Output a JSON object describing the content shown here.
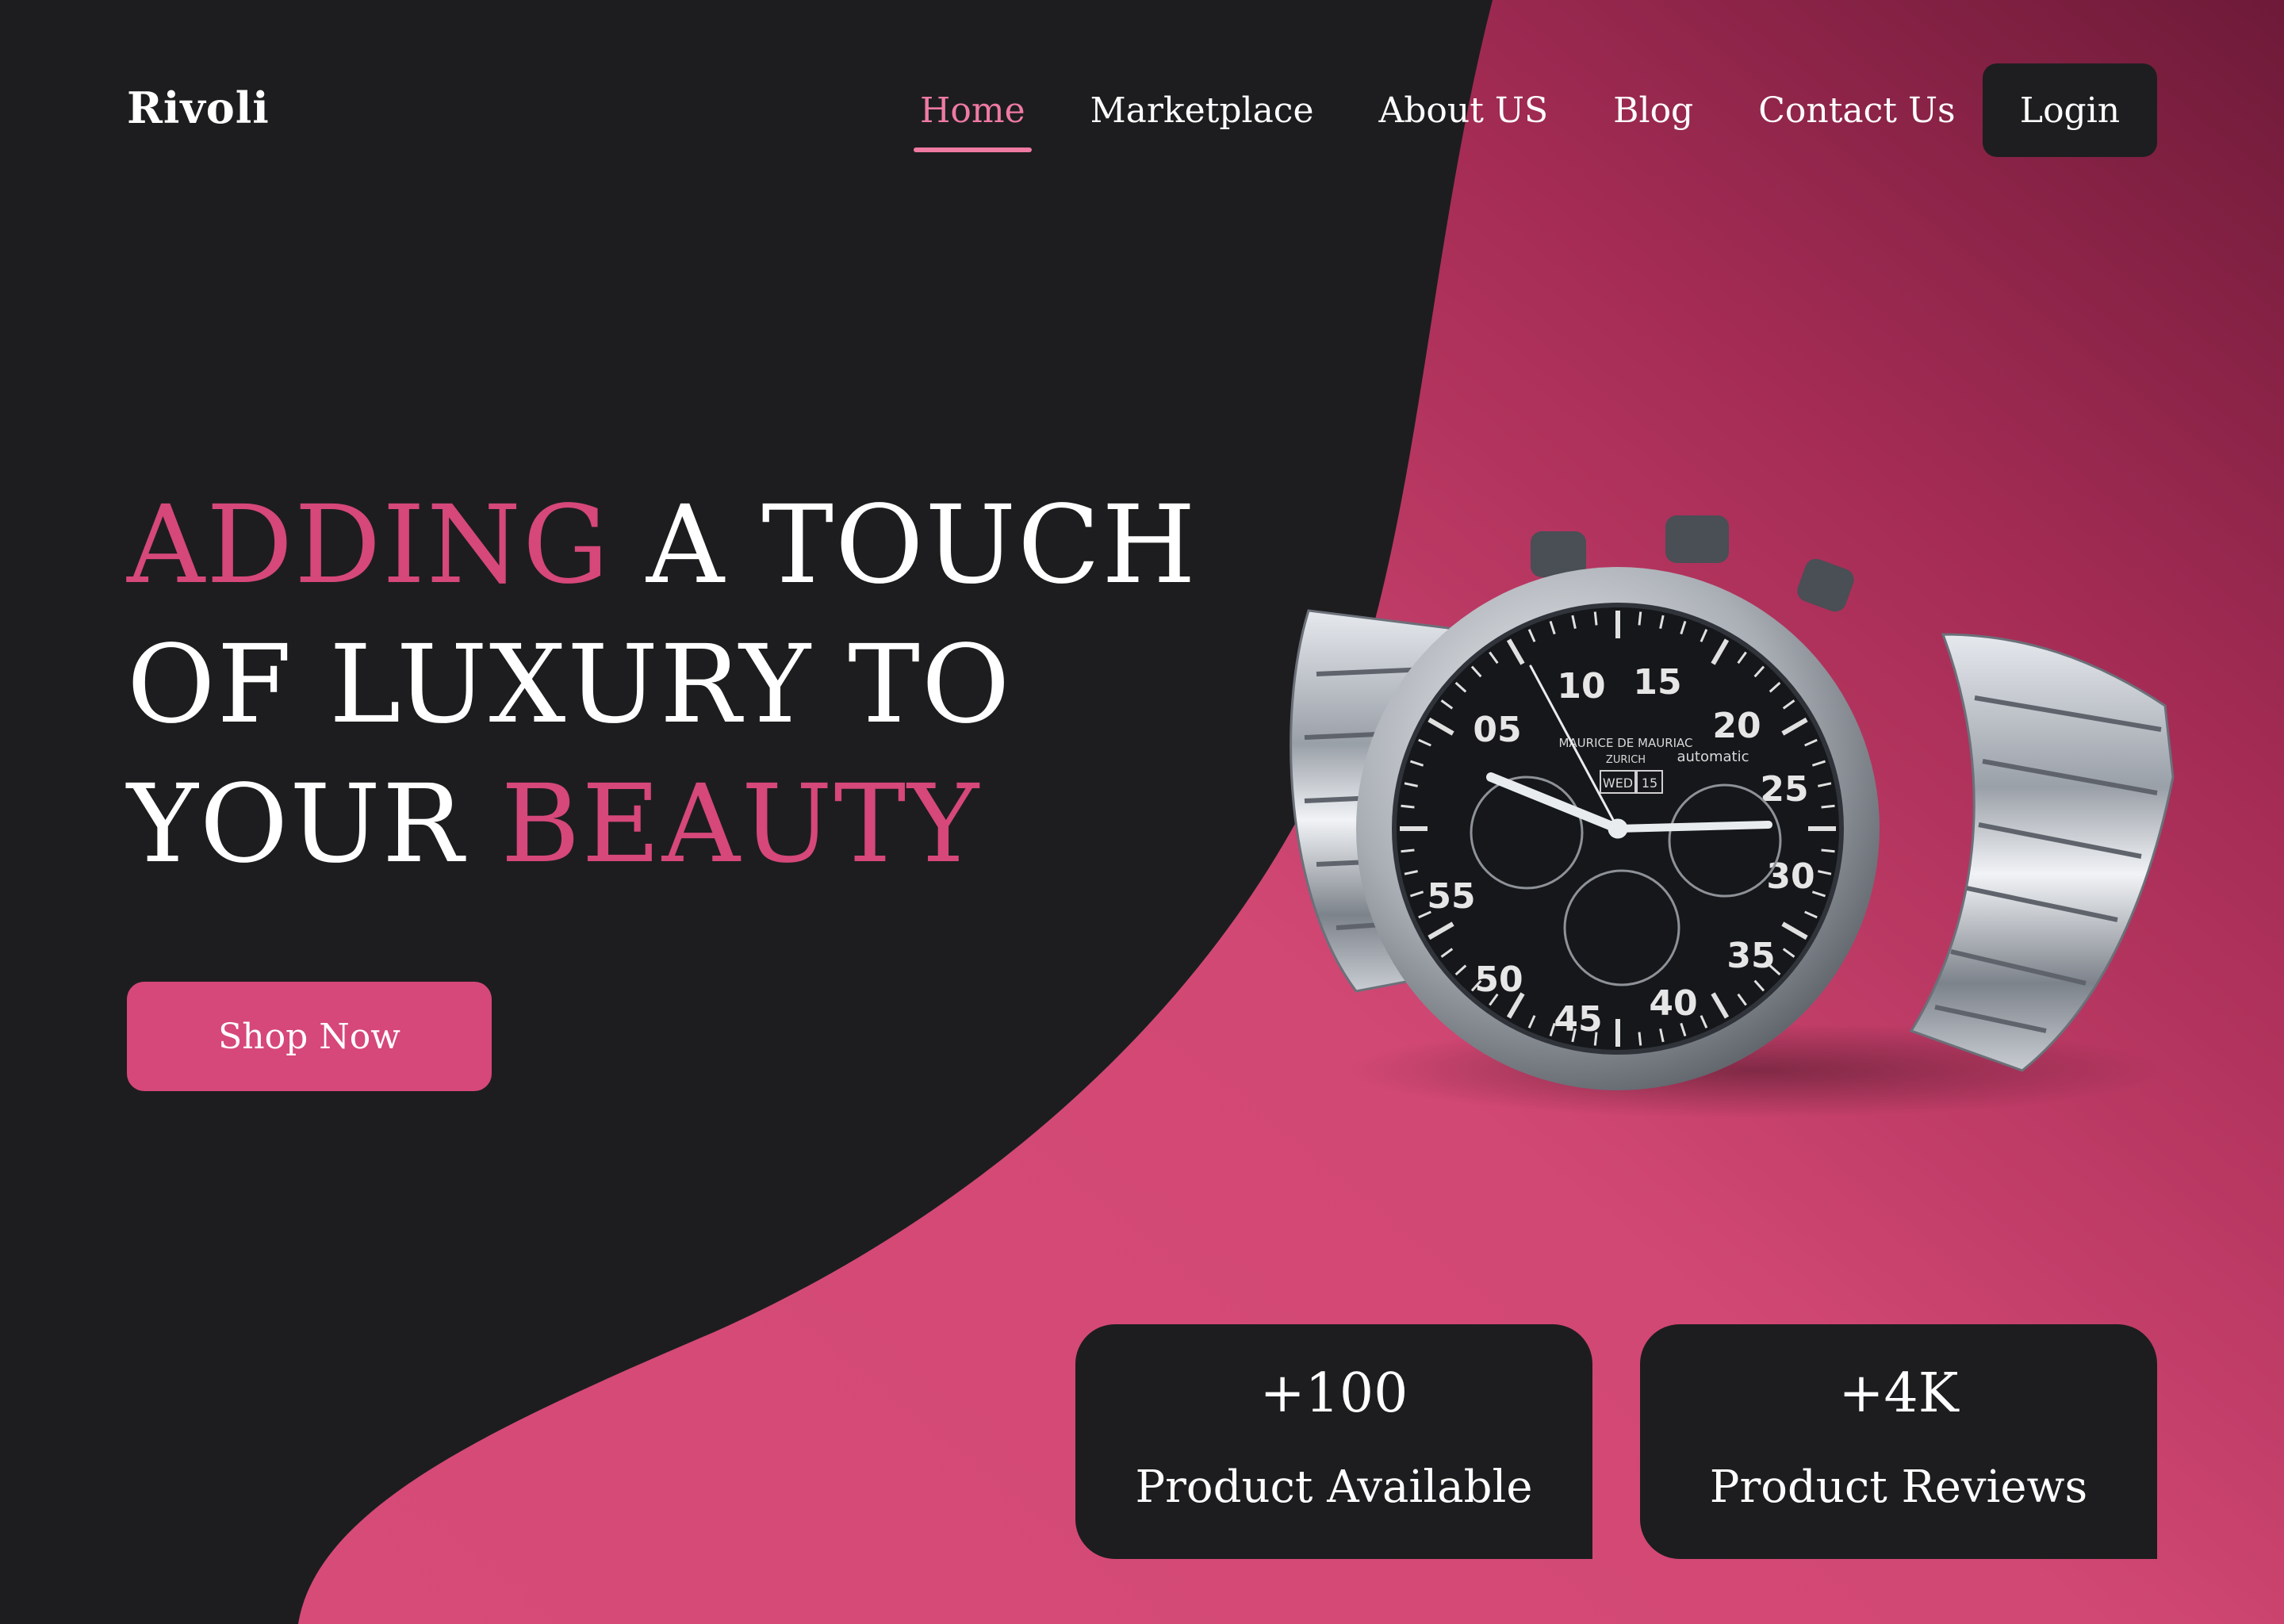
{
  "brand": {
    "name": "Rivoli"
  },
  "nav": {
    "items": [
      {
        "label": "Home",
        "active": true
      },
      {
        "label": "Marketplace",
        "active": false
      },
      {
        "label": "About US",
        "active": false
      },
      {
        "label": "Blog",
        "active": false
      },
      {
        "label": "Contact Us",
        "active": false
      }
    ],
    "login_label": "Login"
  },
  "hero": {
    "line1": {
      "accent": "ADDING",
      "rest": " A TOUCH"
    },
    "line2": {
      "text": "OF LUXURY TO"
    },
    "line3": {
      "text": "YOUR ",
      "accent": "BEAUTY"
    },
    "cta_label": "Shop Now"
  },
  "watch": {
    "brand_text": "MAURICE DE MAURIAC",
    "city_text": "ZURICH",
    "day": "WED",
    "date": "15",
    "automatic": "automatic",
    "numerals": [
      "05",
      "10",
      "15",
      "20",
      "25",
      "30",
      "35",
      "40",
      "45",
      "50",
      "55"
    ]
  },
  "stats": [
    {
      "value": "+100",
      "label": "Product Available"
    },
    {
      "value": "+4K",
      "label": "Product Reviews"
    }
  ],
  "colors": {
    "background": "#1d1d1f",
    "accent": "#d6477a",
    "nav_active": "#ef7aa2",
    "gradient_dark": "#6e1a38"
  }
}
